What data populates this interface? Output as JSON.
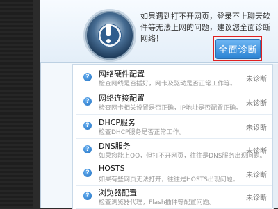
{
  "header": {
    "message": "如果遇到打不开网页，登录不上聊天软件等无法上网的问题，建议您全面诊断网络！",
    "diagnose_button": "全面诊断"
  },
  "items": [
    {
      "title": "网络硬件配置",
      "desc": "检查网线是否插好，网卡及驱动是否正常工作等。",
      "status": "未诊断"
    },
    {
      "title": "网络连接配置",
      "desc": "检查网卡相关设置是否正确，IP地址是否配置正确。",
      "status": "未诊断"
    },
    {
      "title": "DHCP服务",
      "desc": "检查DHCP服务是否正常工作。",
      "status": "未诊断"
    },
    {
      "title": "DNS服务",
      "desc": "如果您能上QQ，但打不开网页，往往是DNS服务出现问题。",
      "status": "未诊断"
    },
    {
      "title": "HOSTS",
      "desc": "如果有些网页无法打开，往往是HOSTS出现问题。",
      "status": "未诊断"
    },
    {
      "title": "浏览器配置",
      "desc": "检查浏览器代理，Flash插件等配置问题。",
      "status": "未诊断"
    }
  ]
}
